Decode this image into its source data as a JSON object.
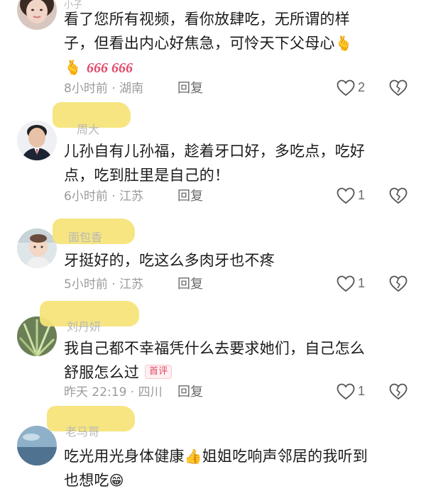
{
  "comments": [
    {
      "username": "小子",
      "text_line1": "看了您所有视频，看你放肆吃，无所谓的样",
      "text_line2": "子，但看出内心好焦急，可怜天下父母心",
      "emoji_after_line2": "🫰",
      "emoji_line3": "🫰",
      "sixes": "666 666",
      "meta": "8小时前 · 湖南",
      "reply_label": "回复",
      "like_count": "2",
      "avatar": "woman-portrait-avatar"
    },
    {
      "username": "周大",
      "text_line1": "儿孙自有儿孙福，趁着牙口好，多吃点，吃好",
      "text_line2": "点，吃到肚里是自己的！",
      "meta": "6小时前 · 江苏",
      "reply_label": "回复",
      "like_count": "1",
      "avatar": "man-in-suit-avatar"
    },
    {
      "username": "面包香",
      "text_line1": "牙挺好的，吃这么多肉牙也不疼",
      "meta": "5小时前 · 江苏",
      "reply_label": "回复",
      "like_count": "1",
      "avatar": "baby-photo-avatar"
    },
    {
      "username": "刘丹妍",
      "text_line1": "我自己都不幸福凭什么去要求她们，自己怎么",
      "text_line2": "舒服怎么过",
      "badge": "首评",
      "meta": "昨天 22:19 · 四川",
      "reply_label": "回复",
      "like_count": "1",
      "avatar": "plant-photo-avatar"
    },
    {
      "username": "老马哥",
      "text_line1": "吃光用光身体健康",
      "emoji_thumb": "👍",
      "text_line1b": "姐姐吃响声邻居的我听到",
      "text_line2": "也想吃",
      "emoji_grin": "😁",
      "avatar": "sky-photo-avatar"
    }
  ],
  "colors": {
    "highlight": "#f6e47a",
    "meta": "#9b9b9b",
    "badge": "#e0485f",
    "text": "#1b1b1b"
  }
}
